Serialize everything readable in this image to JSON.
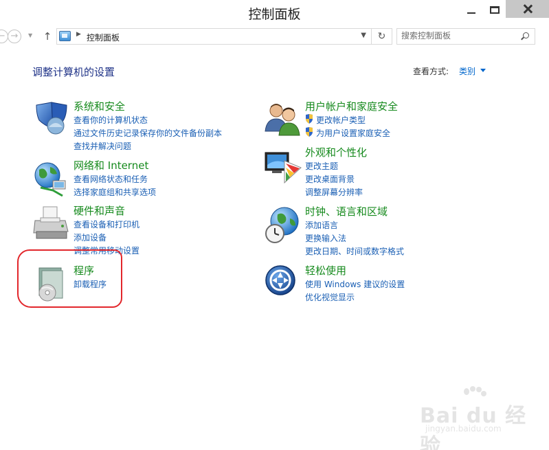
{
  "window": {
    "title": "控制面板"
  },
  "nav": {
    "back_glyph": "←",
    "forward_glyph": "→",
    "recent_glyph": "▼",
    "up_glyph": "↑",
    "address_separator": "▶",
    "address_text": "控制面板",
    "address_dropdown_glyph": "▼",
    "refresh_glyph": "↻",
    "search_placeholder": "搜索控制面板"
  },
  "header": {
    "title": "调整计算机的设置",
    "view_by_label": "查看方式:",
    "view_by_value": "类别"
  },
  "categories": [
    {
      "title": "系统和安全",
      "icon": "shield-icon",
      "links": [
        "查看你的计算机状态",
        "通过文件历史记录保存你的文件备份副本",
        "查找并解决问题"
      ]
    },
    {
      "title": "网络和 Internet",
      "icon": "network-globe-icon",
      "links": [
        "查看网络状态和任务",
        "选择家庭组和共享选项"
      ]
    },
    {
      "title": "硬件和声音",
      "icon": "printer-icon",
      "links": [
        "查看设备和打印机",
        "添加设备",
        "调整常用移动设置"
      ]
    },
    {
      "title": "程序",
      "icon": "programs-disc-icon",
      "links": [
        "卸载程序"
      ]
    },
    {
      "title": "用户帐户和家庭安全",
      "icon": "users-icon",
      "links": [
        "更改帐户类型",
        "为用户设置家庭安全"
      ]
    },
    {
      "title": "外观和个性化",
      "icon": "monitor-palette-icon",
      "links": [
        "更改主题",
        "更改桌面背景",
        "调整屏幕分辨率"
      ]
    },
    {
      "title": "时钟、语言和区域",
      "icon": "clock-globe-icon",
      "links": [
        "添加语言",
        "更换输入法",
        "更改日期、时间或数字格式"
      ]
    },
    {
      "title": "轻松使用",
      "icon": "ease-of-access-icon",
      "links": [
        "使用 Windows 建议的设置",
        "优化视觉显示"
      ]
    }
  ],
  "watermark": {
    "brand": "Bai du 经验",
    "url": "jingyan.baidu.com"
  },
  "colors": {
    "title_green": "#168a1d",
    "link_blue": "#1a5fb4",
    "header_navy": "#1e3287",
    "annotation_red": "#e2262b"
  }
}
